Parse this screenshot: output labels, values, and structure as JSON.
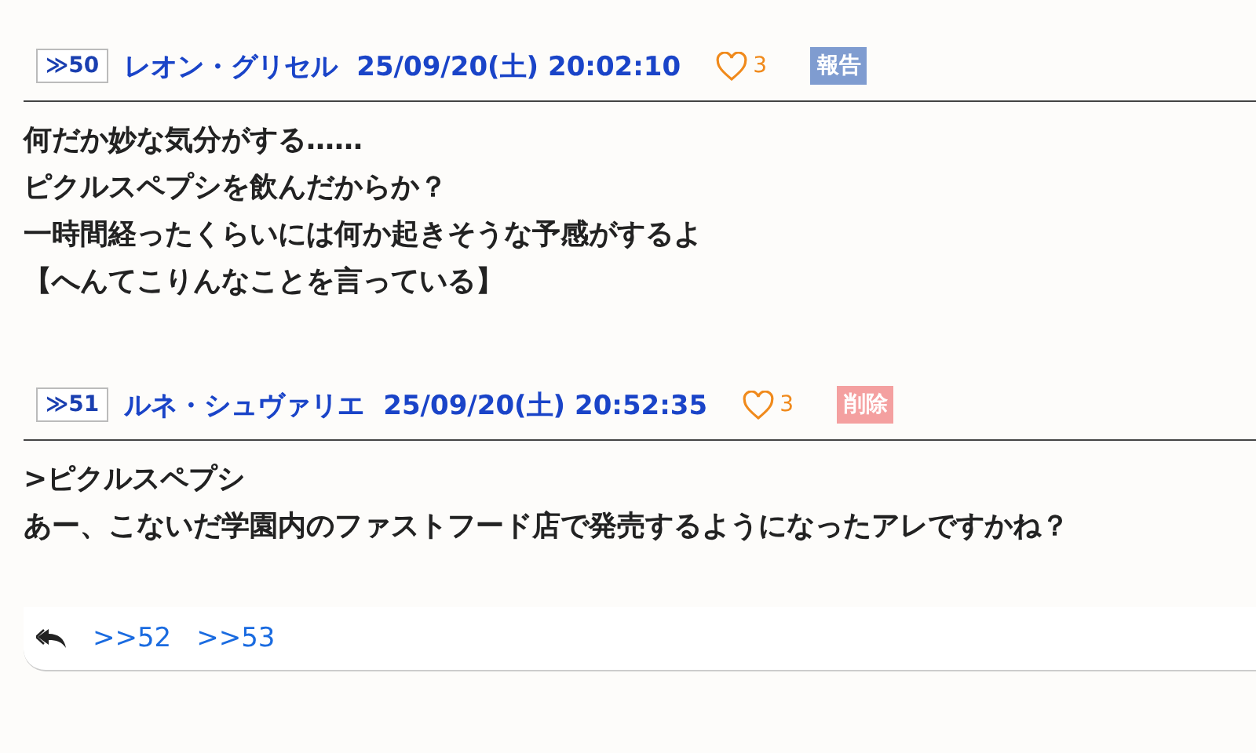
{
  "posts": [
    {
      "anchor": "≫50",
      "author": "レオン・グリセル",
      "date": "25/09/20(土) 20:02:10",
      "likes": "3",
      "action": {
        "kind": "report",
        "label": "報告"
      },
      "lines": [
        "何だか妙な気分がする……",
        "ピクルスペプシを飲んだからか？",
        "一時間経ったくらいには何か起きそうな予感がするよ",
        "【へんてこりんなことを言っている】"
      ]
    },
    {
      "anchor": "≫51",
      "author": "ルネ・シュヴァリエ",
      "date": "25/09/20(土) 20:52:35",
      "likes": "3",
      "action": {
        "kind": "delete",
        "label": "削除"
      },
      "lines": [
        ">ピクルスペプシ",
        "あー、こないだ学園内のファストフード店で発売するようになったアレですかね？"
      ],
      "replies": [
        ">>52",
        ">>53"
      ]
    }
  ]
}
